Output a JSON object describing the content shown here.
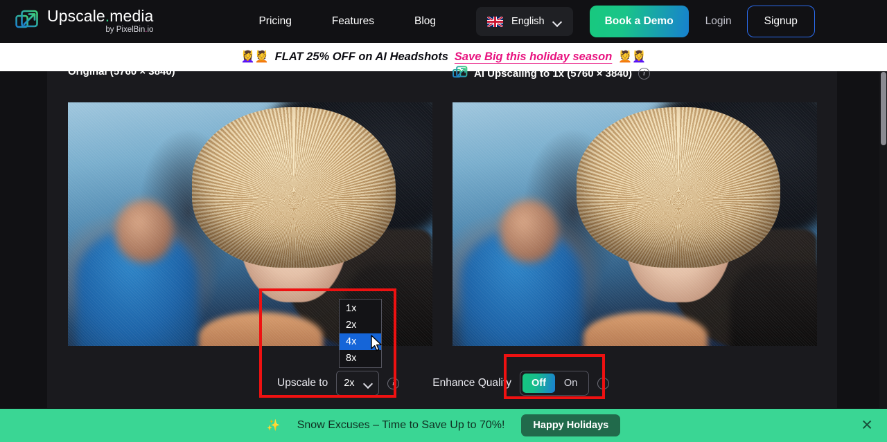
{
  "header": {
    "brand": {
      "title_main": "Upscale",
      "title_dot": ".",
      "title_tail": "media",
      "sub_pre": "by PixelBin",
      "sub_dot": ".",
      "sub_tail": "io",
      "logo_icon": "upscale-arrow-logo"
    },
    "nav": [
      {
        "label": "Pricing",
        "name": "nav-pricing"
      },
      {
        "label": "Features",
        "name": "nav-features"
      },
      {
        "label": "Blog",
        "name": "nav-blog"
      }
    ],
    "language": {
      "label": "English",
      "flag_icon": "uk-flag-icon",
      "chevron_icon": "chevron-down-icon"
    },
    "book_demo_label": "Book a Demo",
    "login_label": "Login",
    "signup_label": "Signup",
    "demo_gradient_from": "#18c97e",
    "demo_gradient_to": "#1780cf",
    "signup_border": "#2b6cf0"
  },
  "promo_banner": {
    "emoji_left": "💆‍♀️💆",
    "text": "FLAT 25% OFF on AI Headshots",
    "link_text": "Save Big this holiday season",
    "emoji_right": "💆💆‍♀️",
    "link_color": "#e8127f",
    "background": "#ffffff"
  },
  "stage": {
    "original_panel": {
      "title": "Original (5760 × 3840)"
    },
    "upscaled_panel": {
      "title": "AI Upscaling to 1x (5760 × 3840)",
      "logo_icon": "upscale-arrow-logo",
      "info_icon": "info-circle-icon"
    }
  },
  "controls": {
    "upscale": {
      "label": "Upscale to",
      "selected_value": "2x",
      "chevron_icon": "chevron-down-icon",
      "info_icon": "info-circle-icon",
      "options": [
        {
          "label": "1x",
          "selected": false
        },
        {
          "label": "2x",
          "selected": false
        },
        {
          "label": "4x",
          "selected": true
        },
        {
          "label": "8x",
          "selected": false
        }
      ],
      "highlight_color": "#1565d8"
    },
    "enhance_quality": {
      "label": "Enhance Quality",
      "option_off": "Off",
      "option_on": "On",
      "active": "Off",
      "info_icon": "info-circle-icon",
      "active_gradient_from": "#16c77f",
      "active_gradient_to": "#1a7ed4"
    }
  },
  "annotations": {
    "color": "#ee1111",
    "boxes": [
      {
        "name": "upscale-dropdown-highlight"
      },
      {
        "name": "enhance-quality-highlight"
      }
    ]
  },
  "cursor": {
    "icon": "mouse-pointer-icon"
  },
  "bottom_banner": {
    "emoji": "✨",
    "text": "Snow Excuses – Time to Save Up to 70%!",
    "button_label": "Happy Holidays",
    "close_icon": "close-x-icon",
    "background": "#3ad694",
    "button_background": "#216a4b"
  }
}
